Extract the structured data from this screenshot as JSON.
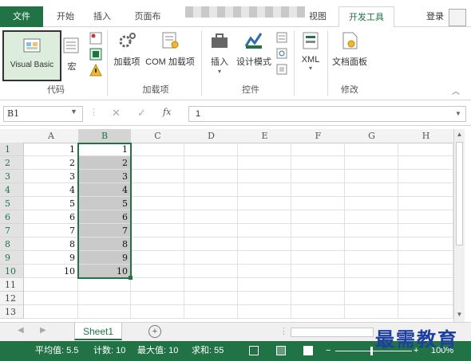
{
  "tabs": [
    "文件",
    "开始",
    "插入",
    "页面布",
    "视图",
    "开发工具"
  ],
  "login": "登录",
  "ribbon": {
    "vb_label": "Visual Basic",
    "macro_label": "宏",
    "addin_label": "加载项",
    "com_label": "COM 加载项",
    "insert_label": "插入",
    "design_label": "设计模式",
    "xml_label": "XML",
    "docpanel_label": "文档面板",
    "groups": [
      "代码",
      "加载项",
      "控件",
      "修改"
    ]
  },
  "formula": {
    "namebox": "B1",
    "fx": "fx",
    "value": "1"
  },
  "columns": [
    "A",
    "B",
    "C",
    "D",
    "E",
    "F",
    "G",
    "H"
  ],
  "rows": [
    "1",
    "2",
    "3",
    "4",
    "5",
    "6",
    "7",
    "8",
    "9",
    "10",
    "11",
    "12",
    "13"
  ],
  "col_a": [
    "1",
    "2",
    "3",
    "4",
    "5",
    "6",
    "7",
    "8",
    "9",
    "10"
  ],
  "col_b": [
    "1",
    "2",
    "3",
    "4",
    "5",
    "6",
    "7",
    "8",
    "9",
    "10"
  ],
  "sheet_tab": "Sheet1",
  "status": {
    "avg": "平均值: 5.5",
    "count": "计数: 10",
    "max": "最大值: 10",
    "sum": "求和: 55",
    "zoom": "100%"
  },
  "watermark": "最需教育",
  "colors": {
    "excel_green": "#217346"
  }
}
